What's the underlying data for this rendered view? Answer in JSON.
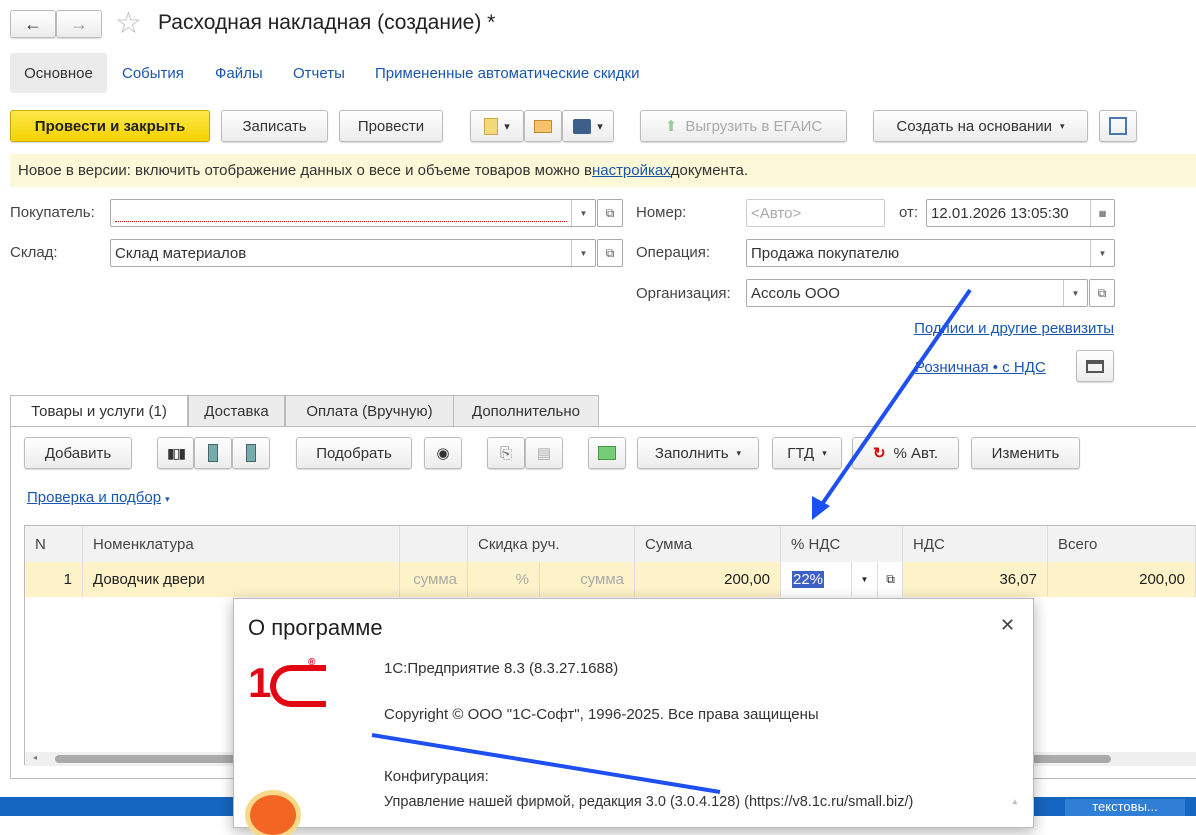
{
  "header": {
    "title": "Расходная накладная (создание) *",
    "back": "←",
    "forward": "→",
    "star": "☆"
  },
  "nav_tabs": [
    "Основное",
    "События",
    "Файлы",
    "Отчеты",
    "Примененные автоматические скидки"
  ],
  "toolbar": {
    "post_close": "Провести и закрыть",
    "save": "Записать",
    "post": "Провести",
    "egais": "Выгрузить в ЕГАИС",
    "create_based": "Создать на основании"
  },
  "info_bar": {
    "text_before": "Новое в версии: включить отображение данных о весе и объеме товаров можно в ",
    "link": "настройках",
    "text_after": " документа."
  },
  "form": {
    "buyer_label": "Покупатель:",
    "buyer_value": "",
    "warehouse_label": "Склад:",
    "warehouse_value": "Склад материалов",
    "number_label": "Номер:",
    "number_placeholder": "<Авто>",
    "date_label": "от:",
    "date_value": "12.01.2026 13:05:30",
    "operation_label": "Операция:",
    "operation_value": "Продажа покупателю",
    "org_label": "Организация:",
    "org_value": "Ассоль ООО",
    "signatures_link": "Подписи и другие реквизиты",
    "price_link": "Розничная • с НДС"
  },
  "doc_tabs": [
    "Товары и услуги (1)",
    "Доставка",
    "Оплата (Вручную)",
    "Дополнительно"
  ],
  "table_toolbar": {
    "add": "Добавить",
    "pick": "Подобрать",
    "fill": "Заполнить",
    "gtd": "ГТД",
    "auto_pct": "% Авт.",
    "change": "Изменить",
    "check_link": "Проверка и подбор"
  },
  "table": {
    "columns": [
      "N",
      "Номенклатура",
      "",
      "Скидка руч.",
      "",
      "Сумма",
      "% НДС",
      "НДС",
      "Всего"
    ],
    "rows": [
      {
        "n": "1",
        "item": "Доводчик двери",
        "disc_sum": "сумма",
        "disc_pct": "%",
        "disc_sum2": "сумма",
        "sum": "200,00",
        "vat_rate": "22%",
        "vat": "36,07",
        "total": "200,00"
      }
    ]
  },
  "dialog": {
    "title": "О программе",
    "close": "✕",
    "logo": "1С",
    "platform": "1С:Предприятие 8.3 (8.3.27.1688)",
    "copyright": "Copyright © ООО \"1С-Софт\", 1996-2025. Все права защищены",
    "config_label": "Конфигурация:",
    "config_value": "Управление нашей фирмой, редакция 3.0 (3.0.4.128) (https://v8.1c.ru/small.biz/)"
  },
  "taskbar": {
    "item": "текстовы..."
  },
  "colors": {
    "accent": "#f5d200",
    "link": "#1a56b0",
    "annotation": "#1e4ff0",
    "row": "#fdf2c8"
  }
}
